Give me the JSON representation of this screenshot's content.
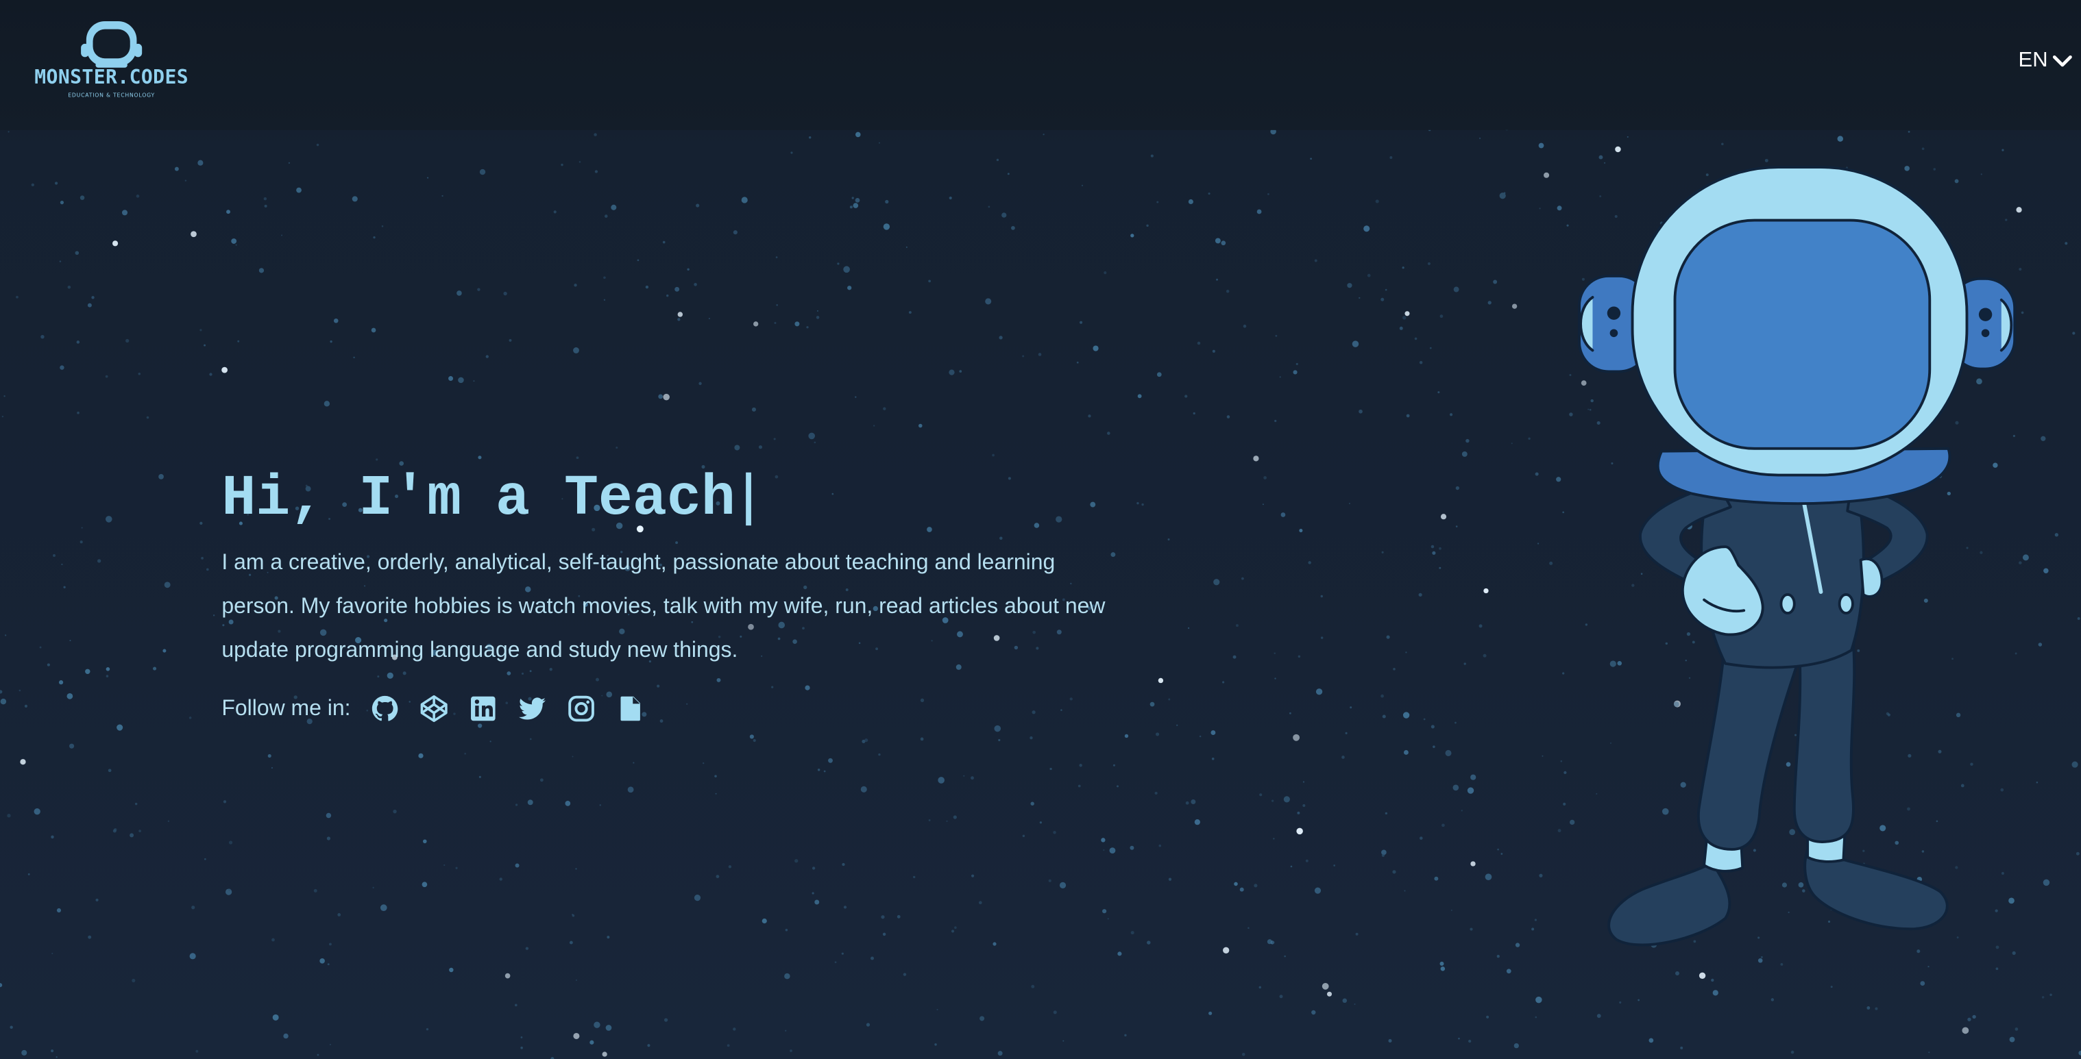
{
  "header": {
    "logo_text": "MONSTER.CODES",
    "logo_tagline": "EDUCATION & TECHNOLOGY",
    "language": "EN"
  },
  "hero": {
    "greeting": "Hi, I'm a Teach",
    "bio": "I am a creative, orderly, analytical, self-taught, passionate about teaching and learning person. My favorite hobbies is watch movies, talk with my wife, run, read articles about new update programming language and study new things.",
    "follow_label": "Follow me in:",
    "social_icons": [
      "github-icon",
      "codepen-icon",
      "linkedin-icon",
      "twitter-icon",
      "instagram-icon",
      "document-icon"
    ]
  },
  "colors": {
    "background": "#172233",
    "accent": "#a3dcf2",
    "text": "#b6dff0",
    "visor": "#4282c8",
    "suit": "#25405d"
  }
}
